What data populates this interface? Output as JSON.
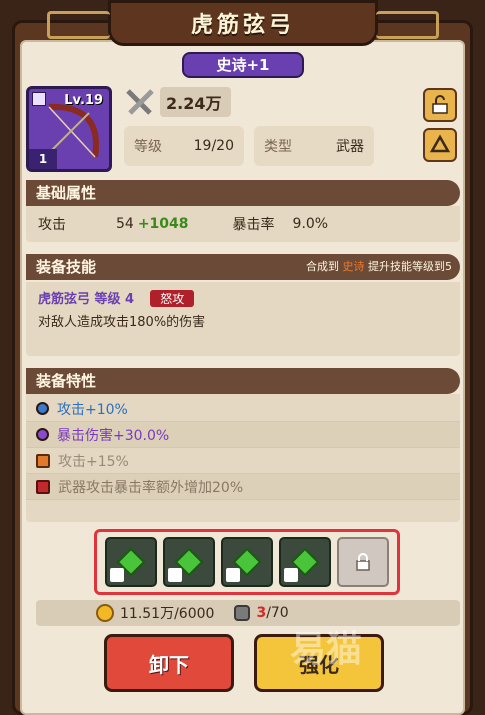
{
  "title": "虎筋弦弓",
  "rarity": "史诗+1",
  "item": {
    "level": "Lv.19",
    "quantity": "1",
    "power": "2.24万"
  },
  "stats": [
    {
      "key": "等级",
      "value": "19/20"
    },
    {
      "key": "类型",
      "value": "武器"
    }
  ],
  "sections": {
    "base": "基础属性",
    "skill": "装备技能",
    "traits": "装备特性"
  },
  "base_attrs": {
    "atk_label": "攻击",
    "atk_value": "54",
    "atk_bonus": "+1048",
    "crit_label": "暴击率",
    "crit_value": "9.0%"
  },
  "skill": {
    "note_prefix": "合成到",
    "note_highlight": "史诗",
    "note_suffix": "提升技能等级到5",
    "name": "虎筋弦弓 等级 4",
    "tag": "怒攻",
    "desc": "对敌人造成攻击180%的伤害"
  },
  "traits": [
    {
      "text": "攻击+10%",
      "icon": "blue-dot-icon"
    },
    {
      "text": "暴击伤害+30.0%",
      "icon": "purple-dot-icon"
    },
    {
      "text": "攻击+15%",
      "icon": "orange-lock-icon"
    },
    {
      "text": "武器攻击暴击率额外增加20%",
      "icon": "red-lock-icon"
    }
  ],
  "cost": {
    "gold": "11.51万/6000",
    "stone_have": "3",
    "stone_need": "/70"
  },
  "buttons": {
    "unequip": "卸下",
    "upgrade": "强化"
  },
  "watermark": "易猫",
  "colors": {
    "epic_purple": "#6a3fb0",
    "bonus_green": "#3a8a1a",
    "warning_red": "#d02a2a",
    "highlight_frame": "#e0343c"
  }
}
